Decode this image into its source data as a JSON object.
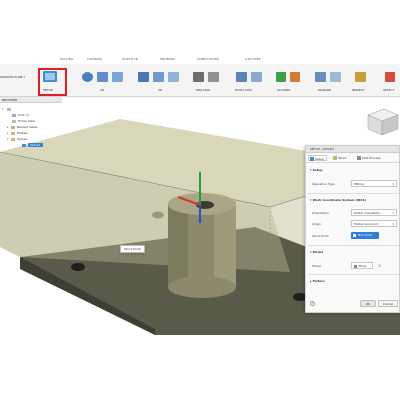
{
  "toolbar": {
    "workspace_label": "MANUFACTURE",
    "tabs": [
      "MILLING",
      "TURNING",
      "ADDITIVE",
      "PROBING",
      "FABRICATION",
      "UTILITIES"
    ],
    "groups": [
      "SETUP",
      "2D",
      "3D",
      "DRILLING",
      "MULTI-AXIS",
      "ACTIONS",
      "MANAGE",
      "INSPECT",
      "SELECT"
    ],
    "highlight_color": "#e0201f"
  },
  "browser": {
    "title": "BROWSER",
    "items": [
      "Unit: in",
      "Home View",
      "Named Views",
      "Models",
      "Setups",
      "Setup1"
    ]
  },
  "viewport": {
    "tooltip": "Stock Point"
  },
  "dialog": {
    "title": "SETUP : SETUP1",
    "tabs": [
      "Setup",
      "Stock",
      "Post Process"
    ],
    "sections": {
      "setup": "Setup",
      "wcs": "Work Coordinate System (WCS)",
      "model": "Model",
      "fixture": "Fixture"
    },
    "operation_type_label": "Operation Type",
    "operation_type_value": "Milling",
    "orientation_label": "Orientation",
    "orientation_value": "Model orientation",
    "origin_label": "Origin",
    "origin_value": "Model box point",
    "stock_point_label": "Stock Point",
    "stock_point_button": "Box Point",
    "model_label": "Model",
    "model_value": "Body",
    "ok_label": "OK",
    "cancel_label": "Cancel"
  }
}
